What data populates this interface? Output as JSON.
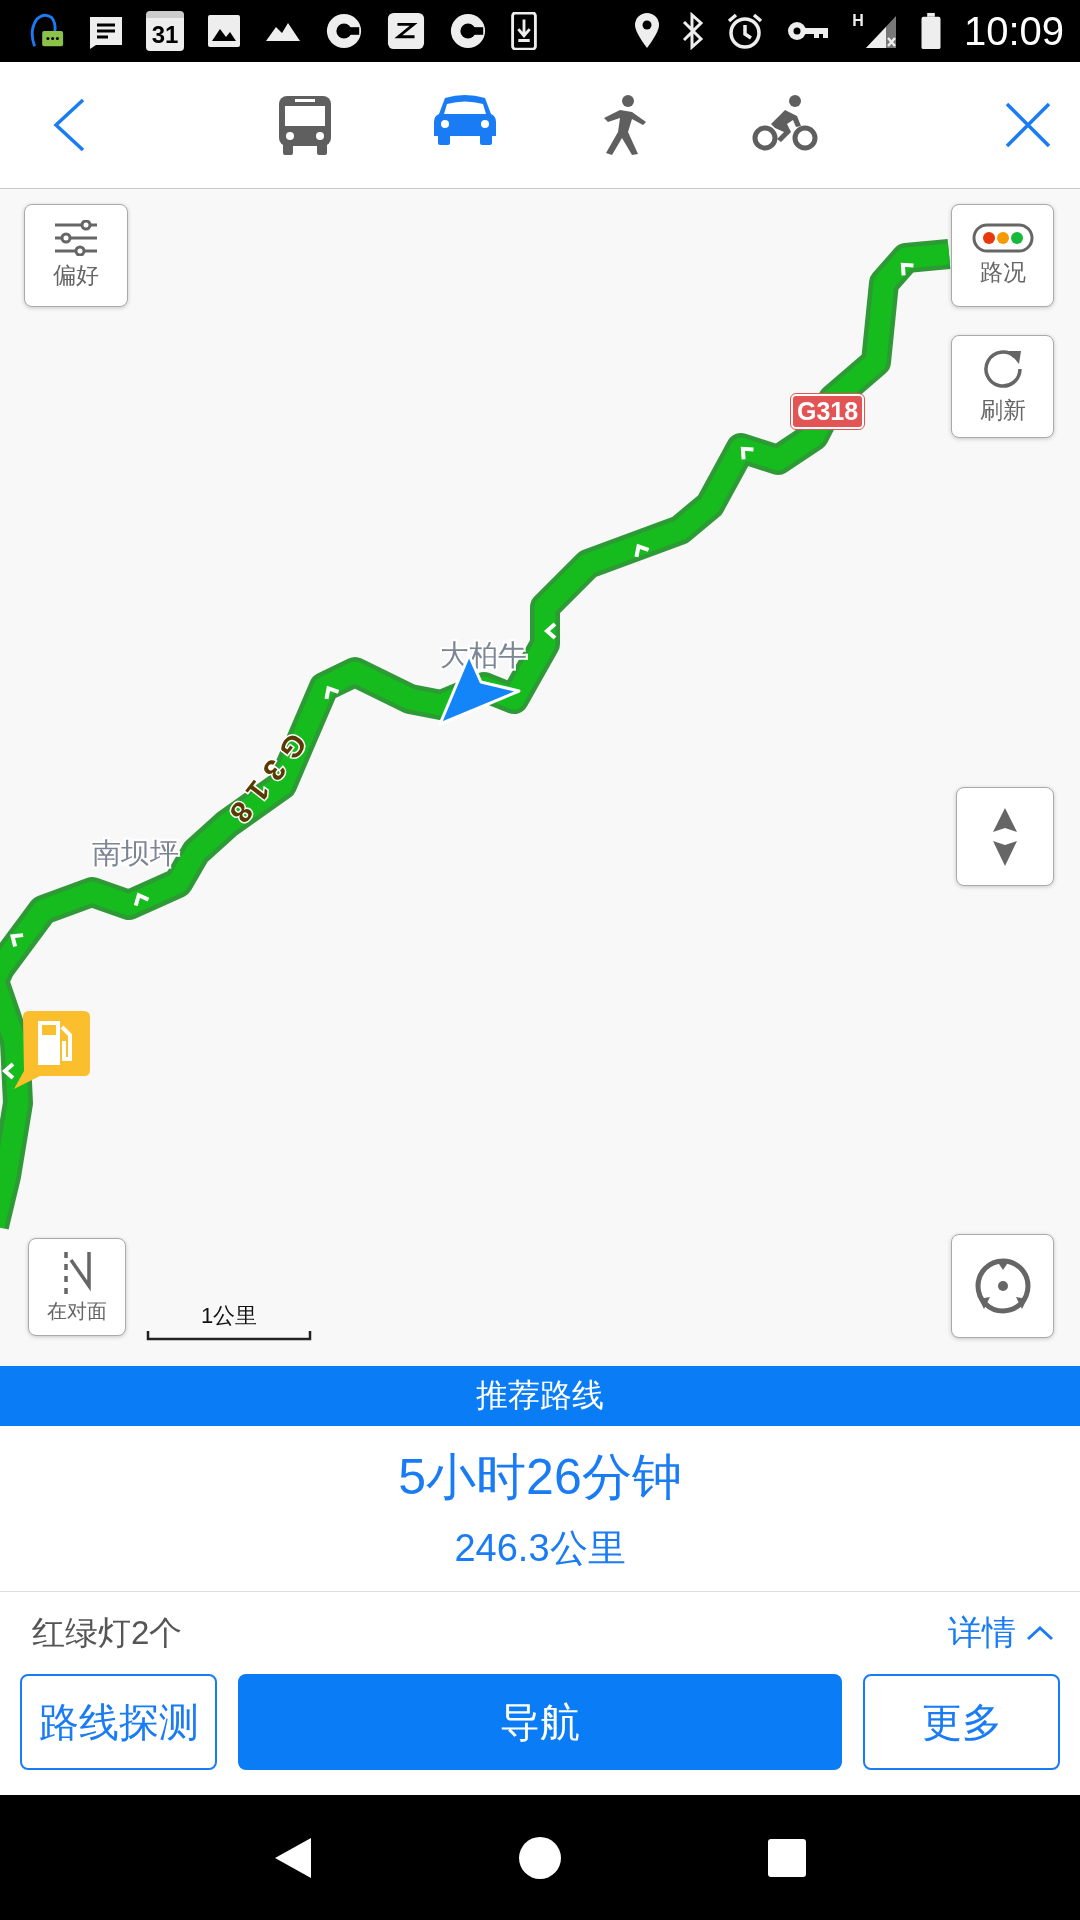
{
  "status_bar": {
    "calendar_day": "31",
    "network": "H",
    "time": "10:09"
  },
  "top_bar": {
    "modes": [
      {
        "kind": "bus",
        "selected": false
      },
      {
        "kind": "car",
        "selected": true
      },
      {
        "kind": "walk",
        "selected": false
      },
      {
        "kind": "bike",
        "selected": false
      }
    ]
  },
  "map": {
    "controls": [
      {
        "kind": "preferences",
        "label": "偏好"
      },
      {
        "kind": "traffic",
        "label": "路况"
      },
      {
        "kind": "refresh",
        "label": "刷新"
      },
      {
        "kind": "tilt"
      },
      {
        "kind": "compass",
        "label": "在对面"
      },
      {
        "kind": "locate"
      }
    ],
    "road_shield": "G318",
    "road_label": "G318",
    "places": [
      "大柏牛",
      "南坝坪"
    ],
    "scale": "1公里"
  },
  "route": {
    "banner": "推荐路线",
    "duration": "5小时26分钟",
    "distance": "246.3公里",
    "traffic_lights": "红绿灯2个",
    "details": "详情"
  },
  "buttons": [
    {
      "kind": "outline",
      "label": "路线探测"
    },
    {
      "kind": "primary",
      "label": "导航"
    },
    {
      "kind": "outline",
      "label": "更多"
    }
  ]
}
